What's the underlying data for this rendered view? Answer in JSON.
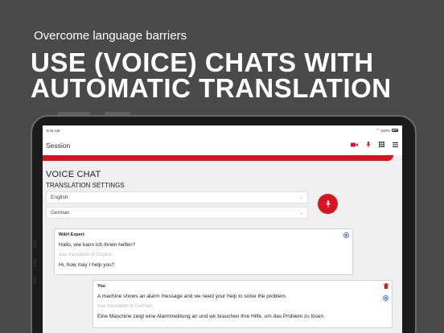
{
  "promo": {
    "subtitle": "Overcome language barriers",
    "title_line1": "USE (VOICE) CHATS WITH",
    "title_line2": "AUTOMATIC TRANSLATION"
  },
  "statusbar": {
    "time": "9:41 AM",
    "battery": "100%"
  },
  "navbar": {
    "title": "Session",
    "icons": [
      "video-icon",
      "microphone-icon",
      "grid-icon",
      "menu-icon"
    ]
  },
  "voice_chat": {
    "heading": "VOICE CHAT",
    "translation_heading": "TRANSLATION SETTINGS",
    "language_from": "English",
    "language_to": "German"
  },
  "messages": [
    {
      "sender": "W&H Expert",
      "original": "Hallo, wie kann ich Ihnen helfen?",
      "translated_note": "was translated to English",
      "translation": "Hi, how may I help you?"
    },
    {
      "sender": "You",
      "original": "A machine shows an alarm message and we need your help to solve the problem.",
      "translated_note": "was translated to German",
      "translation": "Eine Maschine zeigt eine Alarmmeldung an und wir brauchen Ihre Hilfe, um das Problem zu lösen."
    }
  ],
  "colors": {
    "accent": "#d7141f",
    "background": "#4a4a4a",
    "screen": "#efefef",
    "info_icon": "#4a7bd8"
  }
}
